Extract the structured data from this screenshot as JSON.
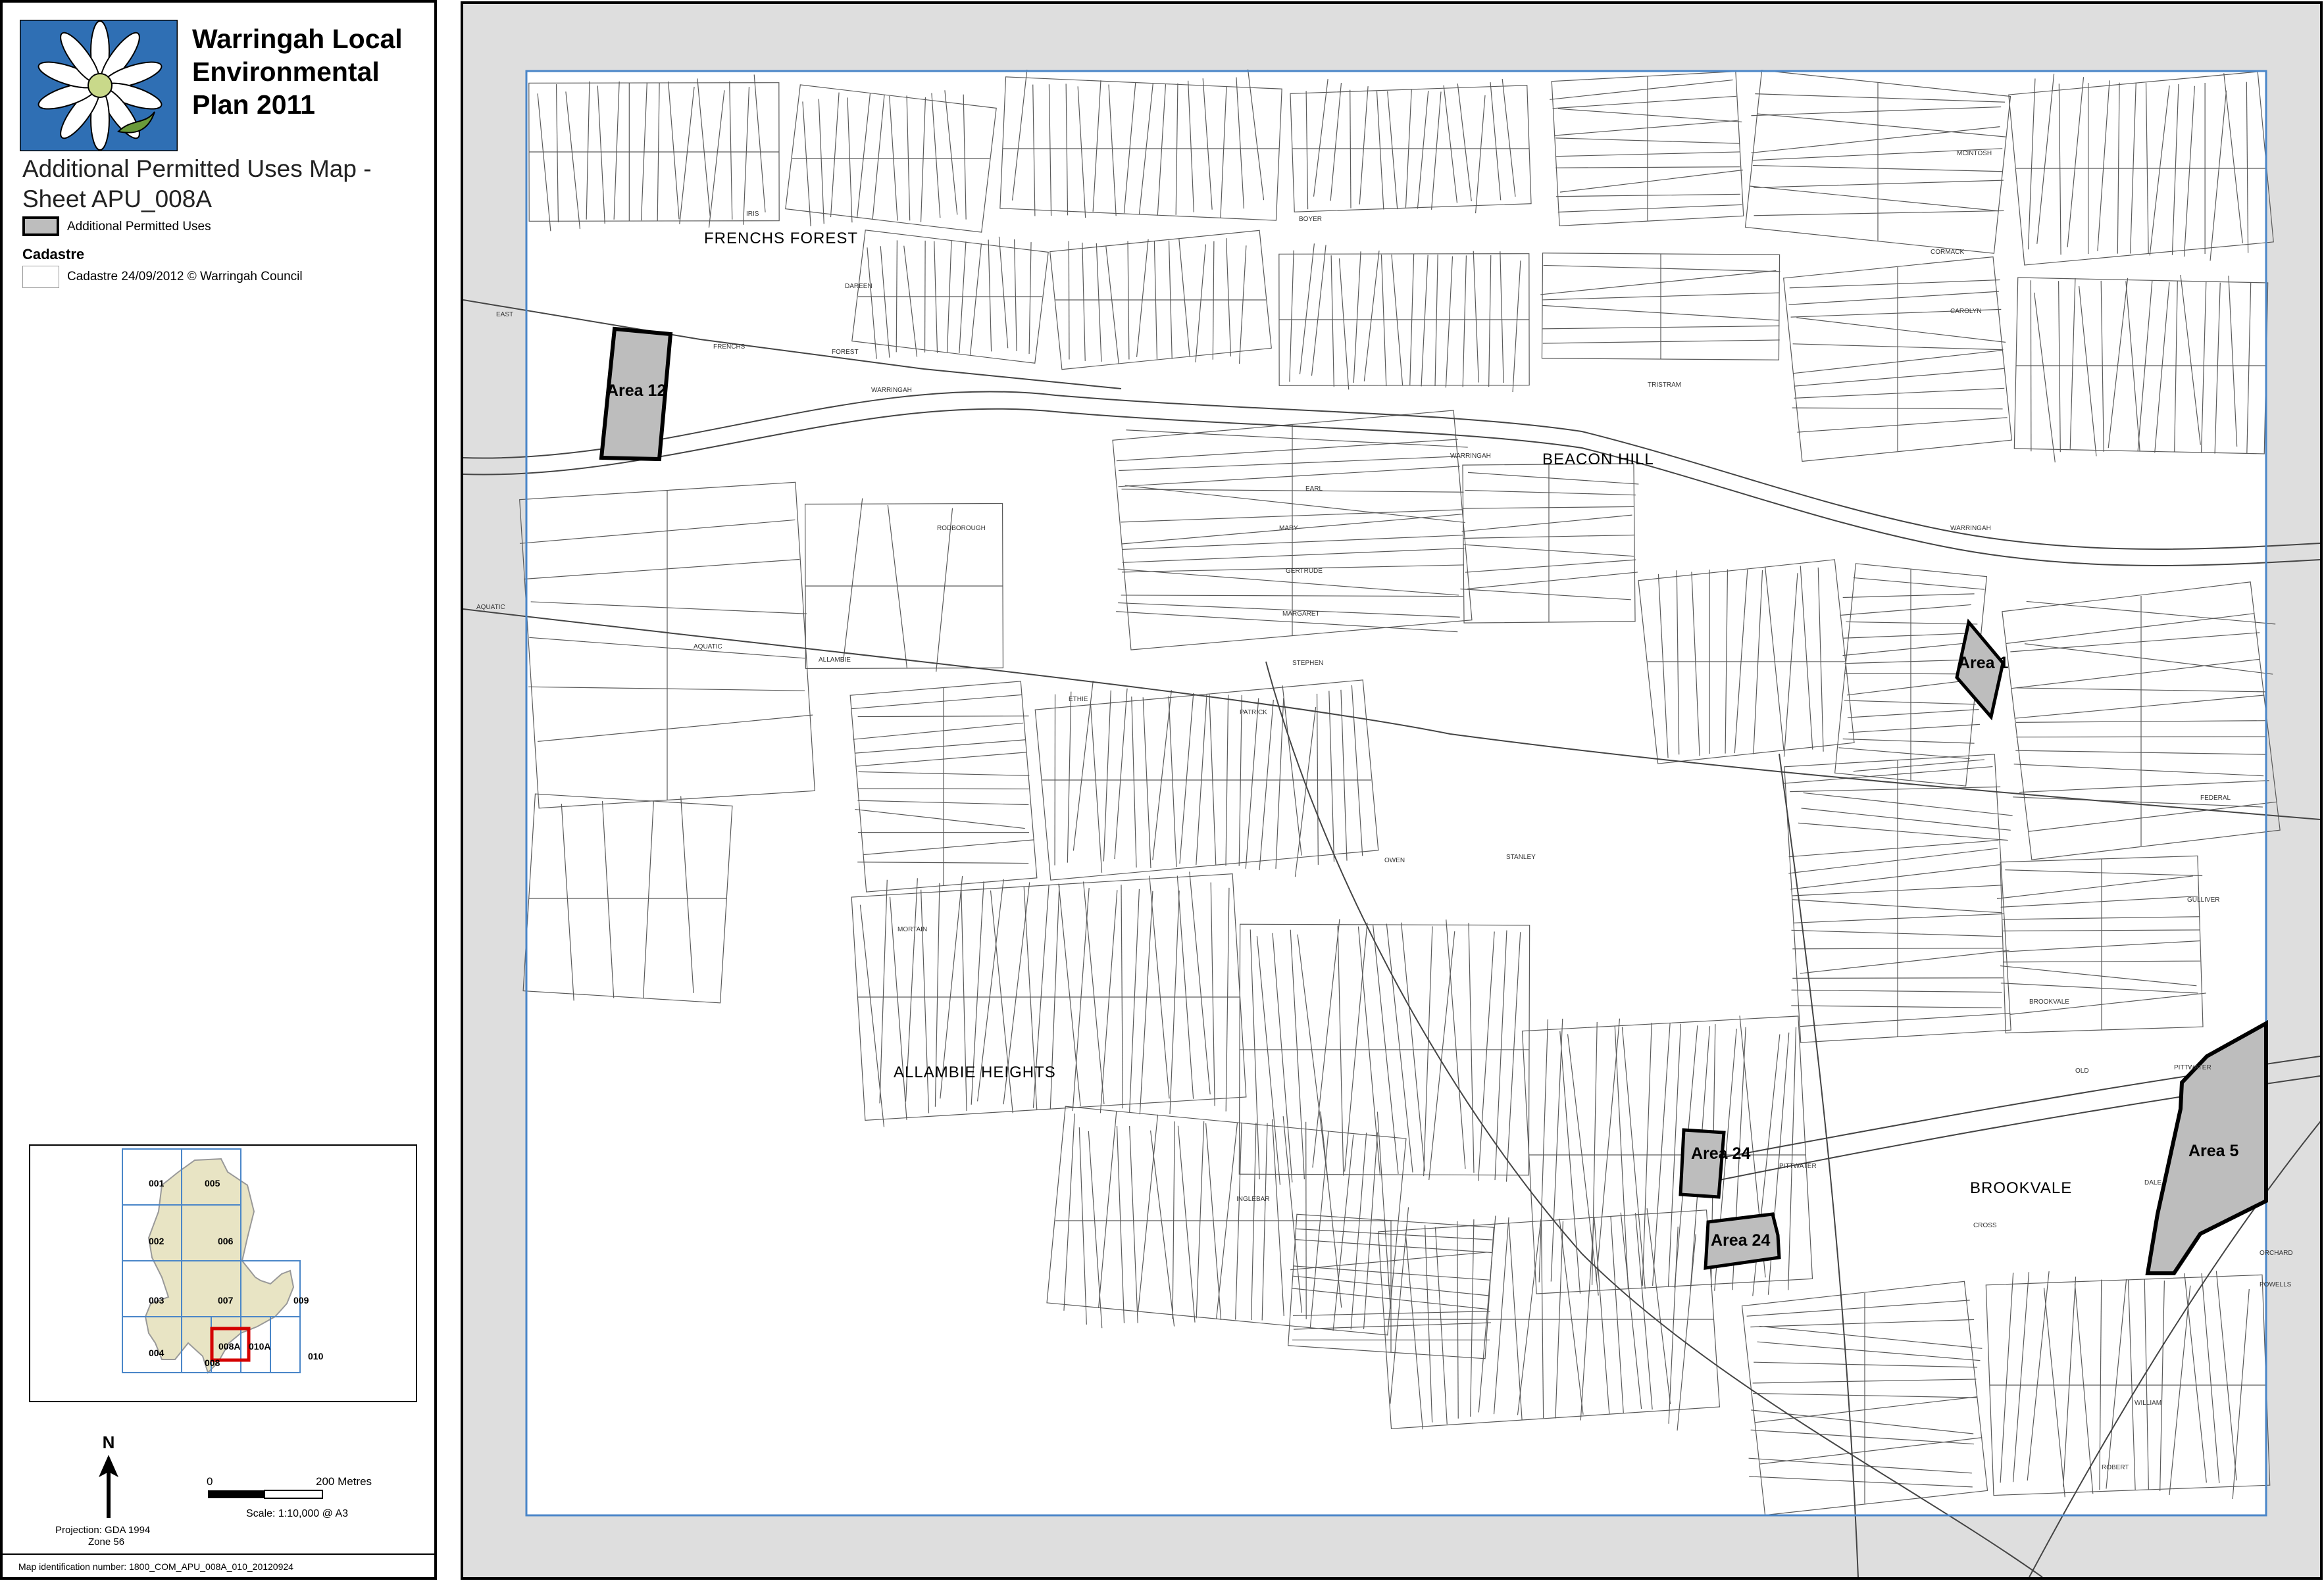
{
  "header": {
    "plan_title_lines": [
      "Warringah Local",
      "Environmental",
      "Plan 2011"
    ],
    "map_title_lines": [
      "Additional Permitted Uses Map -",
      "Sheet APU_008A"
    ]
  },
  "legend": {
    "apu_label": "Additional Permitted Uses",
    "cadastre_heading": "Cadastre",
    "cadastre_label": "Cadastre 24/09/2012 © Warringah Council",
    "colors": {
      "apu_fill": "#bdbdbd",
      "apu_outline": "#000000",
      "cadastre_line": "#999999"
    }
  },
  "locator": {
    "sheets": [
      "001",
      "005",
      "002",
      "006",
      "003",
      "007",
      "009",
      "004",
      "008",
      "008A",
      "010A",
      "010"
    ],
    "current_sheet": "008A",
    "colors": {
      "lga_fill": "#e8e4c4",
      "grid": "#4a86c8",
      "highlight": "#d40000"
    }
  },
  "north": {
    "label": "N"
  },
  "scale": {
    "start": "0",
    "end": "200 Metres",
    "scale_text": "Scale: 1:10,000 @ A3"
  },
  "projection": {
    "line1": "Projection: GDA 1994",
    "line2": "Zone 56"
  },
  "footer": {
    "map_id": "Map identification number: 1800_COM_APU_008A_010_20120924"
  },
  "map": {
    "suburbs": [
      "FRENCHS FOREST",
      "BEACON HILL",
      "ALLAMBIE HEIGHTS",
      "BROOKVALE"
    ],
    "areas": [
      "Area 12",
      "Area 1",
      "Area 24",
      "Area 24",
      "Area 5"
    ],
    "streets": [
      "WARRINGAH",
      "RD",
      "FRENCHS",
      "FOREST",
      "EAST",
      "DAREEN",
      "ST",
      "IRIS",
      "AQUATIC",
      "DR",
      "ALLAMBIE",
      "RODBOROUGH",
      "ETHIE",
      "PATRICK",
      "MORTAIN",
      "TRISTRAM",
      "BOYER",
      "EARL",
      "MARY",
      "GERTRUDE",
      "MARGARET",
      "STEPHEN",
      "PITTWATER",
      "OLD",
      "BROOKVALE",
      "FEDERAL",
      "GULLIVER",
      "ROBERT",
      "WILLIAM",
      "INGLEBAR",
      "ORCHARD",
      "POWELLS",
      "STANLEY",
      "OWEN",
      "LIBERTY",
      "CROSS",
      "DALE",
      "MCINTOSH",
      "CORMACK",
      "CAROLYN"
    ],
    "colors": {
      "frame": "#4a86c8",
      "outside": "#dedede",
      "cadastre": "#5a5a5a",
      "apu_fill": "#bdbdbd"
    }
  }
}
